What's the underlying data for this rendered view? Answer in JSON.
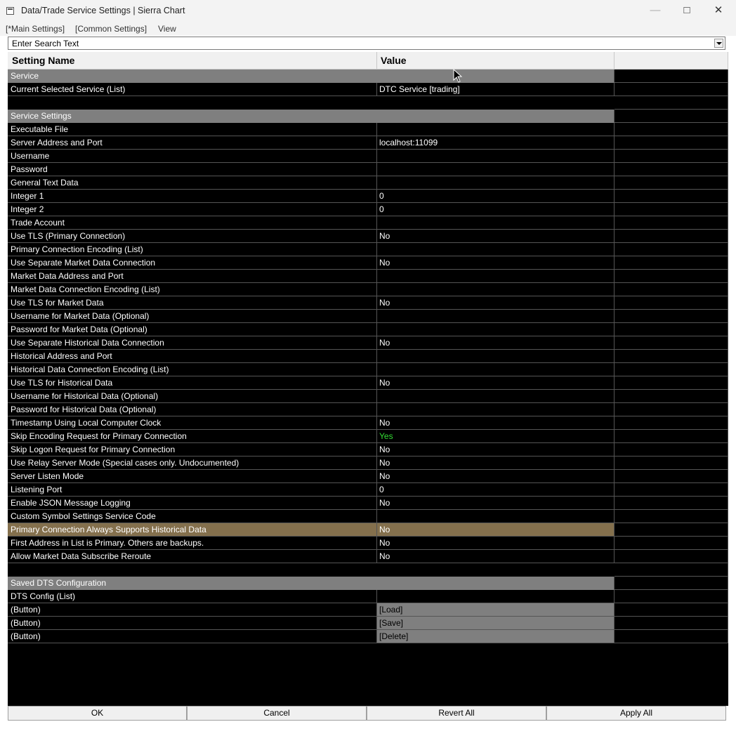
{
  "window": {
    "title": "Data/Trade Service Settings | Sierra Chart",
    "minimize_icon": "minimize-icon",
    "maximize_icon": "maximize-icon",
    "close_icon": "close-icon"
  },
  "menu": {
    "items": [
      "[*Main Settings]",
      "[Common Settings]",
      "View"
    ]
  },
  "search": {
    "placeholder": "Enter Search Text"
  },
  "table": {
    "headers": {
      "name": "Setting Name",
      "value": "Value"
    },
    "rows": [
      {
        "kind": "section",
        "name": "Service",
        "value": ""
      },
      {
        "kind": "setting",
        "name": "Current Selected Service (List)",
        "value": "DTC Service   [trading]"
      },
      {
        "kind": "blank",
        "name": "",
        "value": ""
      },
      {
        "kind": "section",
        "name": "Service Settings",
        "value": ""
      },
      {
        "kind": "setting",
        "name": "Executable File",
        "value": ""
      },
      {
        "kind": "setting",
        "name": "Server Address and Port",
        "value": "localhost:11099"
      },
      {
        "kind": "setting",
        "name": "Username",
        "value": ""
      },
      {
        "kind": "setting",
        "name": "Password",
        "value": ""
      },
      {
        "kind": "setting",
        "name": "General Text Data",
        "value": ""
      },
      {
        "kind": "setting",
        "name": "Integer 1",
        "value": "0"
      },
      {
        "kind": "setting",
        "name": "Integer 2",
        "value": "0"
      },
      {
        "kind": "setting",
        "name": "Trade Account",
        "value": ""
      },
      {
        "kind": "setting",
        "name": "Use TLS (Primary Connection)",
        "value": "No"
      },
      {
        "kind": "setting",
        "name": "Primary Connection Encoding (List)",
        "value": ""
      },
      {
        "kind": "setting",
        "name": "Use Separate Market Data Connection",
        "value": "No"
      },
      {
        "kind": "setting",
        "name": "Market Data Address and Port",
        "value": ""
      },
      {
        "kind": "setting",
        "name": "Market Data Connection Encoding (List)",
        "value": ""
      },
      {
        "kind": "setting",
        "name": "Use TLS for Market Data",
        "value": "No"
      },
      {
        "kind": "setting",
        "name": "Username for Market Data (Optional)",
        "value": ""
      },
      {
        "kind": "setting",
        "name": "Password for Market Data (Optional)",
        "value": ""
      },
      {
        "kind": "setting",
        "name": "Use Separate Historical Data Connection",
        "value": "No"
      },
      {
        "kind": "setting",
        "name": "Historical Address and Port",
        "value": ""
      },
      {
        "kind": "setting",
        "name": "Historical Data Connection Encoding (List)",
        "value": ""
      },
      {
        "kind": "setting",
        "name": "Use TLS for Historical Data",
        "value": "No"
      },
      {
        "kind": "setting",
        "name": "Username for Historical Data (Optional)",
        "value": ""
      },
      {
        "kind": "setting",
        "name": "Password for Historical Data (Optional)",
        "value": ""
      },
      {
        "kind": "setting",
        "name": "Timestamp Using Local Computer Clock",
        "value": "No"
      },
      {
        "kind": "setting",
        "name": "Skip Encoding Request for Primary Connection",
        "value": "Yes",
        "value_color": "#33dd33"
      },
      {
        "kind": "setting",
        "name": "Skip Logon Request for Primary Connection",
        "value": "No"
      },
      {
        "kind": "setting",
        "name": "Use Relay Server Mode (Special cases only. Undocumented)",
        "value": "No"
      },
      {
        "kind": "setting",
        "name": "Server Listen Mode",
        "value": "No"
      },
      {
        "kind": "setting",
        "name": "Listening Port",
        "value": "0"
      },
      {
        "kind": "setting",
        "name": "Enable JSON Message Logging",
        "value": "No"
      },
      {
        "kind": "setting",
        "name": "Custom Symbol Settings Service Code",
        "value": ""
      },
      {
        "kind": "highlight",
        "name": "Primary Connection Always Supports Historical Data",
        "value": "No"
      },
      {
        "kind": "setting",
        "name": "First Address in List is Primary. Others are backups.",
        "value": "No"
      },
      {
        "kind": "setting",
        "name": "Allow Market Data Subscribe Reroute",
        "value": "No"
      },
      {
        "kind": "blank",
        "name": "",
        "value": ""
      },
      {
        "kind": "section",
        "name": "Saved DTS Configuration",
        "value": ""
      },
      {
        "kind": "setting",
        "name": "DTS Config (List)",
        "value": ""
      },
      {
        "kind": "button",
        "name": " (Button)",
        "value": "[Load]"
      },
      {
        "kind": "button",
        "name": " (Button)",
        "value": "[Save]"
      },
      {
        "kind": "button",
        "name": " (Button)",
        "value": "[Delete]"
      }
    ]
  },
  "footer": {
    "buttons": [
      "OK",
      "Cancel",
      "Revert All",
      "Apply All"
    ]
  },
  "colors": {
    "grid_background": "#000000",
    "section_background": "#7f7f7f",
    "highlight_background": "#84704d",
    "yes_value": "#33dd33"
  }
}
